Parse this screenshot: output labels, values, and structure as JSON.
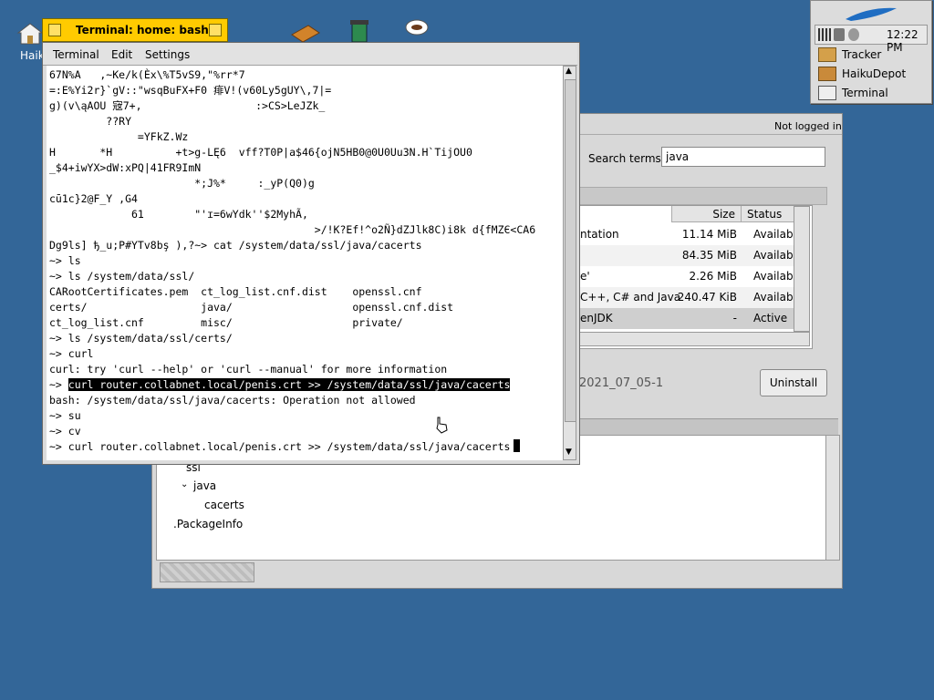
{
  "desktop": {
    "home_label": "Haiku"
  },
  "deskbar": {
    "clock": "12:22 PM",
    "items": [
      {
        "label": "Tracker",
        "icon": "tracker-icon"
      },
      {
        "label": "HaikuDepot",
        "icon": "haikudepot-icon"
      },
      {
        "label": "Terminal",
        "icon": "terminal-icon"
      }
    ]
  },
  "terminal": {
    "title": "Terminal: home: bash",
    "menu": [
      "Terminal",
      "Edit",
      "Settings"
    ],
    "lines": [
      "67N%A   ,~Ke/k(Èx\\%T5vS9,\"%rr*7",
      "=:E%Yi2r}`gV::\"wsqBuFX+F0 痱V!(v60Ly5gUY\\,7|=",
      "g)(v\\ąAOU 宼7+,                  :>CS>LeJZk_",
      "         ??RY",
      "              =YFkZ.Wz",
      "H       *H          +t>g-LĘ6  vff?T0P|a$46{ojN5HB0@0U0Uu3N.H`TijOU0",
      "_$4+iwYX>dW:xPQ|41FR9ImN",
      "                       *;J%*     :_yP(Q0)g",
      "cū1c}2@F_Y ,G4",
      "             61        \"'ɪ=6wYdk''$2MyhÃ,",
      "                                          >/!K?Ef!^o2Ñ}dZJlk8C)i8k d{fMZЄ<CA6",
      "Dg9ls] ђ_u;P#YTv8bş ),?~> cat /system/data/ssl/java/cacerts",
      "~> ls",
      "~> ls /system/data/ssl/",
      "CARootCertificates.pem  ct_log_list.cnf.dist    openssl.cnf",
      "certs/                  java/                   openssl.cnf.dist",
      "ct_log_list.cnf         misc/                   private/",
      "~> ls /system/data/ssl/certs/",
      "~> curl",
      "curl: try 'curl --help' or 'curl --manual' for more information"
    ],
    "hl_prompt": "~> ",
    "hl_command": "curl router.collabnet.local/penis.crt >> /system/data/ssl/java/cacerts",
    "lines2": [
      "bash: /system/data/ssl/java/cacerts: Operation not allowed",
      "~> su",
      "~> cv"
    ],
    "current_input": "~> curl router.collabnet.local/penis.crt >> /system/data/ssl/java/cacerts"
  },
  "depot": {
    "login_status": "Not logged in",
    "search_label": "Search terms:",
    "search_value": "java",
    "columns": [
      "Size",
      "Status"
    ],
    "rows": [
      {
        "name": "ntation",
        "size": "11.14 MiB",
        "status": "Available"
      },
      {
        "name": "",
        "size": "84.35 MiB",
        "status": "Available"
      },
      {
        "name": "e'",
        "size": "2.26 MiB",
        "status": "Available"
      },
      {
        "name": "C++, C# and Java",
        "size": "240.47 KiB",
        "status": "Available"
      },
      {
        "name": "enJDK",
        "size": "-",
        "status": "Active"
      }
    ],
    "version": "2021_07_05-1",
    "uninstall_label": "Uninstall",
    "tree": [
      "ssl",
      "java",
      "cacerts",
      ".PackageInfo"
    ]
  }
}
